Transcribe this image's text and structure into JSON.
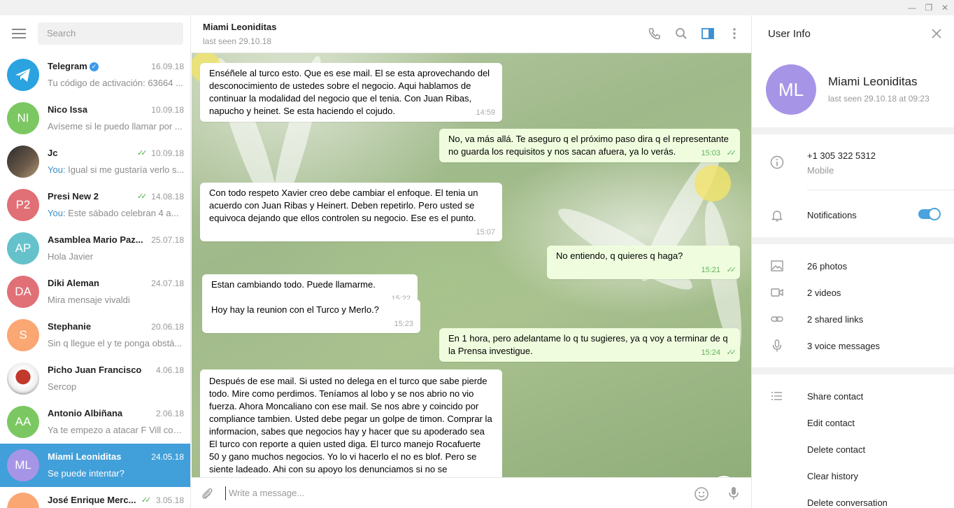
{
  "window": {
    "minimize": "—",
    "restore": "❐",
    "close": "✕"
  },
  "sidebar": {
    "search_placeholder": "Search",
    "chats": [
      {
        "name": "Telegram",
        "verified": true,
        "date": "16.09.18",
        "preview": "Tu código de activación: 63664 ...",
        "avatar_color": "#2aa3e0",
        "avatar_text": "",
        "icon": "telegram-plane-icon"
      },
      {
        "name": "Nico Issa",
        "date": "10.09.18",
        "preview": "Avíseme si le puedo llamar por ...",
        "avatar_color": "#7bc862",
        "avatar_text": "NI"
      },
      {
        "name": "Jc",
        "date": "10.09.18",
        "you": "You:",
        "preview": " Igual si me gustaría verlo s...",
        "avatar_color": "#4a4a4a",
        "avatar_text": "",
        "read": true
      },
      {
        "name": "Presi New 2",
        "date": "14.08.18",
        "you": "You:",
        "preview": " Este sábado celebran 4 a...",
        "avatar_color": "#e17076",
        "avatar_text": "P2",
        "read": true
      },
      {
        "name": "Asamblea Mario Paz...",
        "date": "25.07.18",
        "preview": "Hola Javier",
        "avatar_color": "#65c2cb",
        "avatar_text": "AP"
      },
      {
        "name": "Diki Aleman",
        "date": "24.07.18",
        "preview": "Mira mensaje vivaldi",
        "avatar_color": "#e17076",
        "avatar_text": "DA"
      },
      {
        "name": "Stephanie",
        "date": "20.06.18",
        "preview": "Sin q llegue el y te ponga obstá...",
        "avatar_color": "#faa774",
        "avatar_text": "S"
      },
      {
        "name": "Picho Juan Francisco",
        "date": "4.06.18",
        "preview": "Sercop",
        "avatar_color": "#c0392b",
        "avatar_text": ""
      },
      {
        "name": "Antonio Albiñana",
        "date": "2.06.18",
        "preview": "Ya te empezo a atacar F Vill con...",
        "avatar_color": "#7bc862",
        "avatar_text": "AA"
      },
      {
        "name": "Miami Leoniditas",
        "date": "24.05.18",
        "preview": "Se puede intentar?",
        "avatar_color": "#a695e7",
        "avatar_text": "ML",
        "active": true
      },
      {
        "name": "José Enrique Merc...",
        "date": "3.05.18",
        "preview": "",
        "avatar_color": "#faa774",
        "avatar_text": "",
        "read": true
      }
    ]
  },
  "chat": {
    "title": "Miami Leoniditas",
    "status": "last seen 29.10.18",
    "composer_placeholder": "Write a message...",
    "messages": [
      {
        "dir": "in",
        "text": "Enséñele al turco esto. Que es ese mail. El se esta aprovechando del desconocimiento de ustedes sobre el negocio. Aqui hablamos de continuar la modalidad del negocio que el tenia. Con Juan Ribas, napucho y heinet. Se esta haciendo el cojudo.",
        "time": "14:59"
      },
      {
        "dir": "out",
        "text": "No, va más allá. Te aseguro q el próximo paso dira q el representante no guarda los requisitos y nos sacan afuera, ya lo verás.",
        "time": "15:03"
      },
      {
        "dir": "in",
        "text": "Con todo respeto Xavier creo debe cambiar el enfoque. El tenia un acuerdo con Juan Ribas y Heinert. Deben repetirlo. Pero usted se equivoca dejando que ellos controlen su negocio. Ese es el punto.",
        "time": "15:07"
      },
      {
        "dir": "out",
        "text": "No entiendo, q quieres q haga?",
        "time": "15:21"
      },
      {
        "dir": "in",
        "text": "Estan cambiando todo. Puede llamarme.",
        "time": "15:22"
      },
      {
        "dir": "in",
        "text": "Hoy hay la reunion con el Turco y Merlo.?",
        "time": "15:23"
      },
      {
        "dir": "out",
        "text": "En 1 hora, pero adelantame lo q tu sugieres, ya q voy a terminar de q la Prensa investigue.",
        "time": "15:24"
      },
      {
        "dir": "in",
        "text": "Después de ese mail. Si usted no delega en el turco que sabe pierde todo. Mire como perdimos. Teníamos al lobo y se nos abrio no vio fuerza. Ahora Moncaliano con ese mail. Se nos abre y coincido por compliance tambien. Usted debe pegar un golpe de timon. Comprar la informacion, sabes que negocios hay y hacer que su apoderado sea El turco con reporte a quien usted diga. El turco manejo Rocafuerte 50 y gano muchos negocios. Yo lo vi hacerlo el no es blof. Pero se siente ladeado. Ahi con su apoyo los denunciamos si no se",
        "time": ""
      }
    ]
  },
  "info": {
    "header": "User Info",
    "name": "Miami Leoniditas",
    "avatar_text": "ML",
    "avatar_color": "#a695e7",
    "last_seen": "last seen 29.10.18 at 09:23",
    "phone": "+1 305 322 5312",
    "phone_label": "Mobile",
    "notifications_label": "Notifications",
    "notifications_on": true,
    "media": {
      "photos": "26 photos",
      "videos": "2 videos",
      "links": "2 shared links",
      "voice": "3 voice messages"
    },
    "actions": {
      "share": "Share contact",
      "edit": "Edit contact",
      "delete": "Delete contact",
      "clear": "Clear history",
      "delete_conv": "Delete conversation"
    }
  }
}
